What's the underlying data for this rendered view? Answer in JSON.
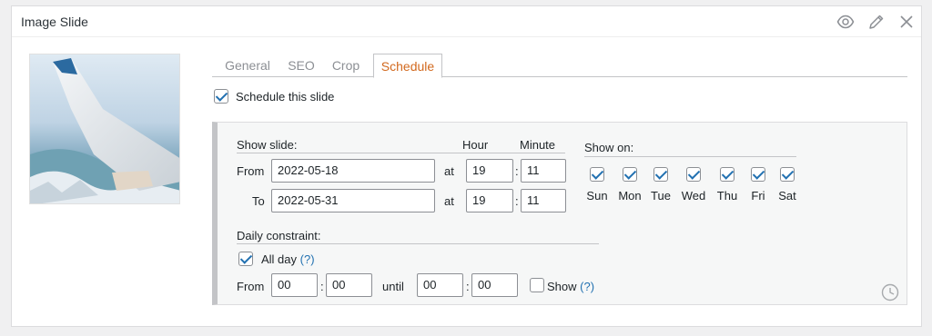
{
  "panel": {
    "title": "Image Slide"
  },
  "tabs": [
    {
      "label": "General"
    },
    {
      "label": "SEO"
    },
    {
      "label": "Crop"
    },
    {
      "label": "Schedule",
      "active": true
    }
  ],
  "schedule_this": {
    "label": "Schedule this slide",
    "checked": true
  },
  "show_slide": {
    "label": "Show slide:",
    "hour_label": "Hour",
    "minute_label": "Minute",
    "from_label": "From",
    "to_label": "To",
    "at_label": "at",
    "colon": ":",
    "from_date": "2022-05-18",
    "from_hour": "19",
    "from_minute": "11",
    "to_date": "2022-05-31",
    "to_hour": "19",
    "to_minute": "11"
  },
  "show_on": {
    "label": "Show on:",
    "days": [
      "Sun",
      "Mon",
      "Tue",
      "Wed",
      "Thu",
      "Fri",
      "Sat"
    ]
  },
  "daily": {
    "label": "Daily constraint:",
    "all_day_label": "All day",
    "help": "(?)",
    "from_label": "From",
    "until_label": "until",
    "colon": ":",
    "from_hour": "00",
    "from_minute": "00",
    "until_hour": "00",
    "until_minute": "00",
    "show_label": "Show",
    "show_help": "(?)"
  },
  "colors": {
    "accent": "#d2691e",
    "link": "#2271b1"
  }
}
